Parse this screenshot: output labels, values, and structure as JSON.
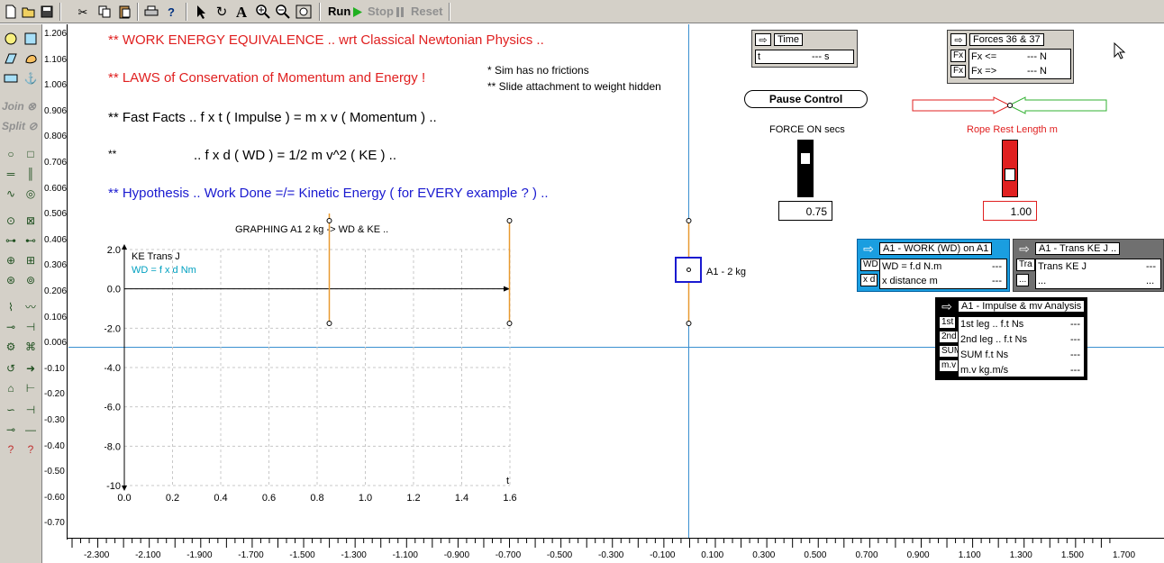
{
  "toolbar": {
    "run_label": "Run",
    "stop_label": "Stop",
    "reset_label": "Reset",
    "icons": [
      "new-icon",
      "open-icon",
      "save-icon",
      "cut-icon",
      "copy-icon",
      "paste-icon",
      "print-icon",
      "help-icon",
      "pointer-icon",
      "rotate-icon",
      "text-icon",
      "zoom-in-icon",
      "zoom-out-icon",
      "zoom-fit-icon"
    ],
    "text_tool_glyph": "A"
  },
  "palette": {
    "join_label": "Join",
    "split_label": "Split"
  },
  "ruler_left": [
    "1.206",
    "1.106",
    "1.006",
    "0.906",
    "0.806",
    "0.706",
    "0.606",
    "0.506",
    "0.406",
    "0.306",
    "0.206",
    "0.106",
    "0.006",
    "-0.10",
    "-0.20",
    "-0.30",
    "-0.40",
    "-0.50",
    "-0.60",
    "-0.70"
  ],
  "ruler_bottom": [
    "-2.300",
    "-2.100",
    "-1.900",
    "-1.700",
    "-1.500",
    "-1.300",
    "-1.100",
    "-0.900",
    "-0.700",
    "-0.500",
    "-0.300",
    "-0.100",
    "0.100",
    "0.300",
    "0.500",
    "0.700",
    "0.900",
    "1.100",
    "1.300",
    "1.500",
    "1.700"
  ],
  "texts": {
    "line1": "** WORK ENERGY EQUIVALENCE .. wrt Classical Newtonian Physics ..",
    "line2": "** LAWS of Conservation of Momentum and Energy !",
    "line3": "** Fast Facts .. f x t  ( Impulse )  =   m x v  ( Momentum )  ..",
    "line4a": "**",
    "line4b": ".. f x d  ( WD )  =  1/2 m v^2  ( KE )  ..",
    "line5": "** Hypothesis .. Work Done =/= Kinetic Energy ( for EVERY example   ? )  ..",
    "note1": "* Sim has no frictions",
    "note2": "** Slide attachment to weight hidden"
  },
  "graph": {
    "title": "GRAPHING A1 2 kg -> WD & KE ..",
    "legend_ke": "KE Trans J",
    "legend_wd": "WD = f x d Nm",
    "x_label": "t"
  },
  "chart_data": {
    "type": "line",
    "title": "GRAPHING A1 2 kg -> WD & KE ..",
    "xlabel": "t",
    "ylabel": "",
    "x_ticks": [
      "0.0",
      "0.2",
      "0.4",
      "0.6",
      "0.8",
      "1.0",
      "1.2",
      "1.4",
      "1.6"
    ],
    "y_ticks": [
      "2.0",
      "0.0",
      "-2.0",
      "-4.0",
      "-6.0",
      "-8.0",
      "-10"
    ],
    "xlim": [
      0,
      1.6
    ],
    "ylim": [
      -10,
      2
    ],
    "grid": true,
    "series": [
      {
        "name": "KE Trans J",
        "x": [],
        "y": [],
        "color": "#000000"
      },
      {
        "name": "WD = f x d Nm",
        "x": [],
        "y": [],
        "color": "#00a0c0"
      }
    ]
  },
  "mass": {
    "label": "A1 - 2 kg"
  },
  "time_panel": {
    "title": "Time",
    "var": "t",
    "value": "--- s"
  },
  "forces_panel": {
    "title": "Forces 36 & 37",
    "btn1": "Fx",
    "btn2": "Fx",
    "row1_label": "Fx <=",
    "row1_value": "--- N",
    "row2_label": "Fx =>",
    "row2_value": "--- N"
  },
  "pause_label": "Pause Control",
  "force_on": {
    "label": "FORCE ON secs",
    "value": "0.75",
    "level": 0.75
  },
  "rope": {
    "label": "Rope Rest Length m",
    "value": "1.00",
    "level": 0.35
  },
  "wd_panel": {
    "title": "A1 - WORK (WD) on A1",
    "btn1": "WD",
    "btn2": "x d",
    "row1": "WD = f.d N.m",
    "row1_value": "---",
    "row2": "x distance m",
    "row2_value": "---"
  },
  "ke_panel": {
    "title": "A1 - Trans KE J ..",
    "btn1": "Tra",
    "btn2": "...",
    "row1": "Trans KE J",
    "row1_value": "---",
    "row2": "...",
    "row2_value": "..."
  },
  "impulse_panel": {
    "title": "A1 - Impulse & mv Analysis",
    "btns": [
      "1st",
      "2nd",
      "SUM",
      "m.v"
    ],
    "rows": [
      "1st leg .. f.t Ns",
      "2nd leg .. f.t Ns",
      "SUM f.t Ns",
      "m.v kg.m/s"
    ],
    "values": [
      "---",
      "---",
      "---",
      "---"
    ]
  },
  "colors": {
    "accent_blue": "#1a9ee0",
    "rope_green": "#30b030",
    "rope_red": "#e02020",
    "orange": "#e89a30"
  }
}
